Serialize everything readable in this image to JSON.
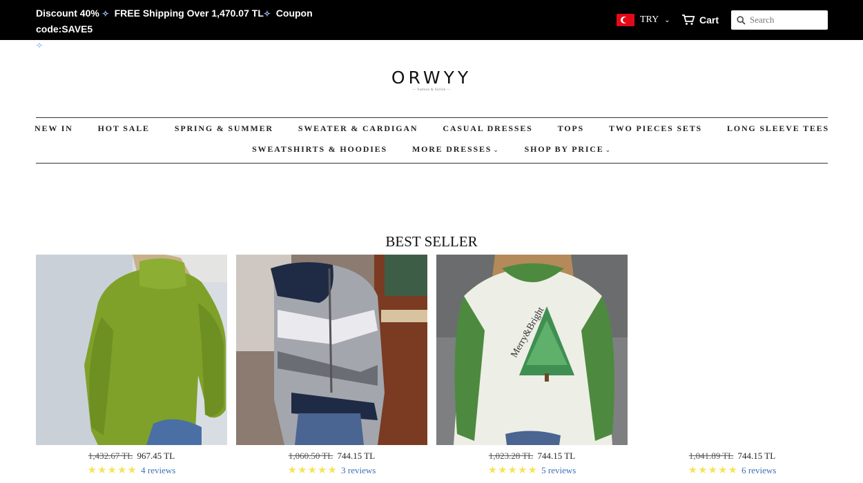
{
  "announcement": {
    "line1": "Discount 40%",
    "line2": "FREE Shipping Over 1,470.07 TL",
    "line3": "Coupon code:SAVE5"
  },
  "header": {
    "currency": "TRY",
    "cart_label": "Cart",
    "search_placeholder": "Search"
  },
  "logo": {
    "name": "ORWYY",
    "tagline": "— Fashion & Stylish —"
  },
  "nav": {
    "row1": [
      "NEW IN",
      "HOT SALE",
      "SPRING & SUMMER",
      "SWEATER & CARDIGAN",
      "CASUAL DRESSES",
      "TOPS",
      "TWO PIECES SETS",
      "LONG SLEEVE TEES"
    ],
    "row2": [
      "SWEATSHIRTS & HOODIES",
      "MORE DRESSES",
      "SHOP BY PRICE"
    ]
  },
  "section_title": "BEST SELLER",
  "products": [
    {
      "old_price": "1,432.67 TL",
      "price": "967.45 TL",
      "reviews": "4 reviews",
      "rating": 5
    },
    {
      "old_price": "1,060.50 TL",
      "price": "744.15 TL",
      "reviews": "3 reviews",
      "rating": 5
    },
    {
      "old_price": "1,023.28 TL",
      "price": "744.15 TL",
      "reviews": "5 reviews",
      "rating": 5
    },
    {
      "old_price": "1,041.89 TL",
      "price": "744.15 TL",
      "reviews": "6 reviews",
      "rating": 5
    }
  ],
  "colors": {
    "topbar": "#000000",
    "review_link": "#3f6fb6",
    "star": "#f7e35a"
  }
}
